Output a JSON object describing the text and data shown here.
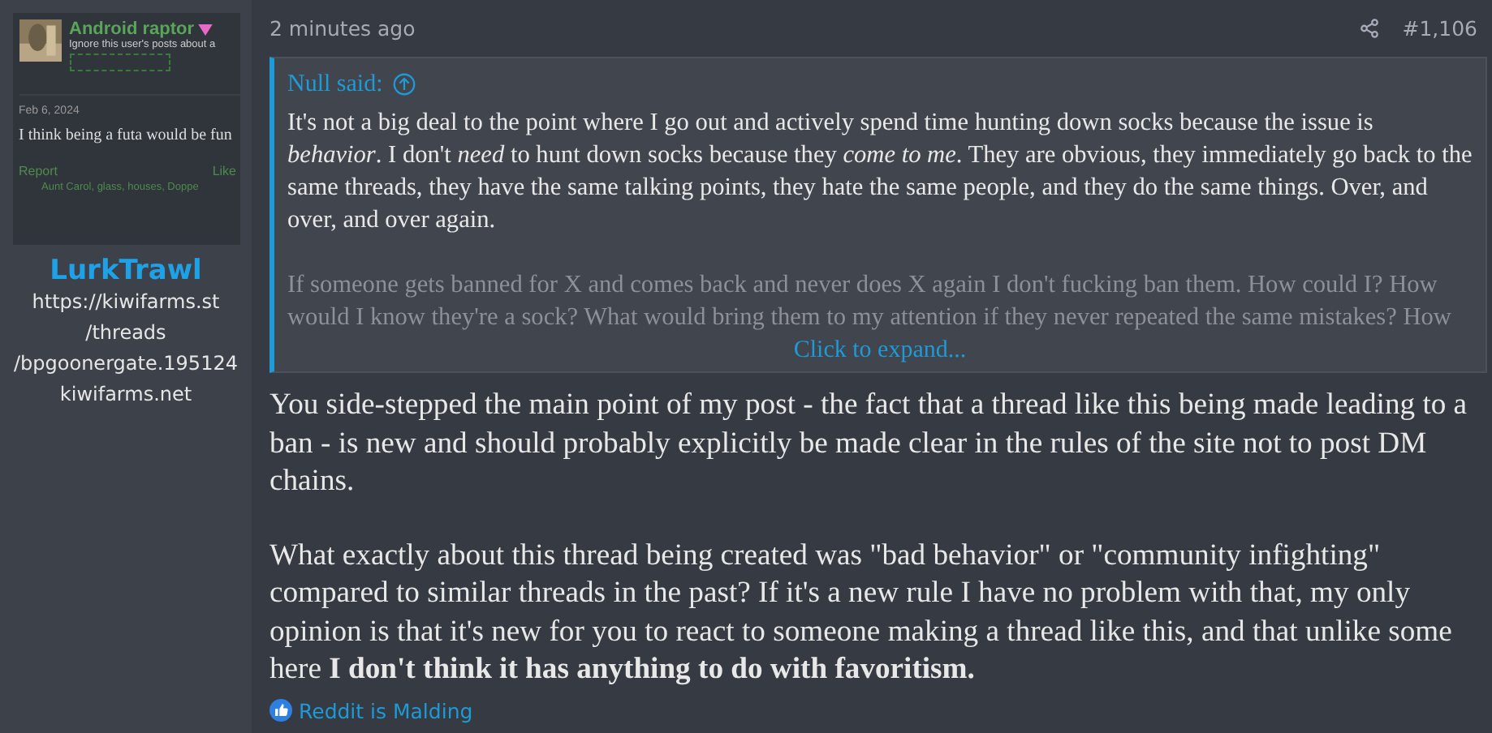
{
  "author": {
    "avatar": {
      "kind": "screenshot",
      "name": "Android raptor",
      "note": "Ignore this user's posts about a",
      "date": "Feb 6, 2024",
      "text": "I think being a futa would be fun",
      "report": "Report",
      "like": "Like",
      "reactions": "Aunt Carol, glass, houses, Doppe"
    },
    "username": "LurkTrawl",
    "title_lines": [
      "https://kiwifarms.st",
      "/threads",
      "/bpgoonergate.195124",
      "kiwifarms.net"
    ]
  },
  "post": {
    "time": "2 minutes ago",
    "number": "#1,106",
    "quote": {
      "author": "Null said:",
      "paragraphs": [
        "It's not a big deal to the point where I go out and actively spend time hunting down socks because the issue is *behavior*. I don't *need* to hunt down socks because they *come to me*. They are obvious, they immediately go back to the same threads, they have the same talking points, they hate the same people, and they do the same things. Over, and over, and over again.",
        "If someone gets banned for X and comes back and never does X again I don't fucking ban them. How could I? How would I know they're a sock? What would bring them to my attention if they never repeated the same mistakes? How"
      ],
      "expand": "Click to expand..."
    },
    "paragraphs": [
      "You side-stepped the main point of my post - the fact that a thread like this being made leading to a ban - is new and should probably explicitly be made clear in the rules of the site not to post DM chains.",
      "What exactly about this thread being created was \"bad behavior\" or \"community infighting\" compared to similar threads in the past? If it's a new rule I have no problem with that, my only opinion is that it's new for you to react to someone making a thread like this, and that unlike some here **I don't think it has anything to do with favoritism.**"
    ],
    "reactions": "Reddit is Malding"
  }
}
